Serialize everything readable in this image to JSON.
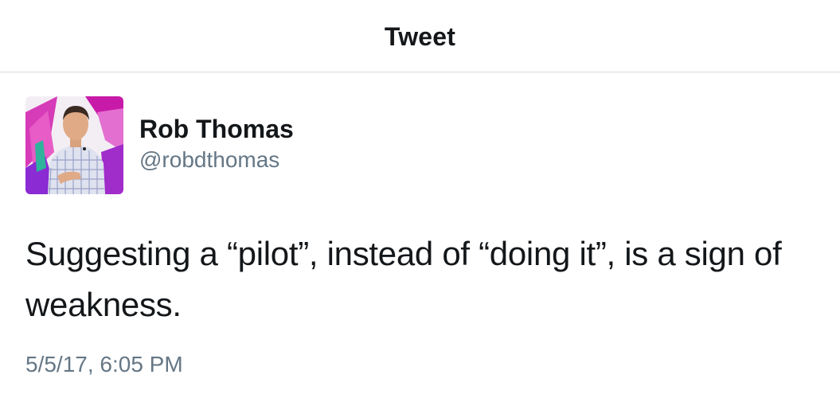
{
  "header": {
    "title": "Tweet"
  },
  "tweet": {
    "author_name": "Rob Thomas",
    "author_handle": "@robdthomas",
    "text": "Suggesting a “pilot”, instead of “doing it”, is a sign of weakness.",
    "timestamp": "5/5/17, 6:05 PM",
    "avatar": "profile-photo"
  },
  "colors": {
    "text_primary": "#14171a",
    "text_secondary": "#657786",
    "divider": "#d6d9dc",
    "avatar_accent": "#c81aa8"
  }
}
